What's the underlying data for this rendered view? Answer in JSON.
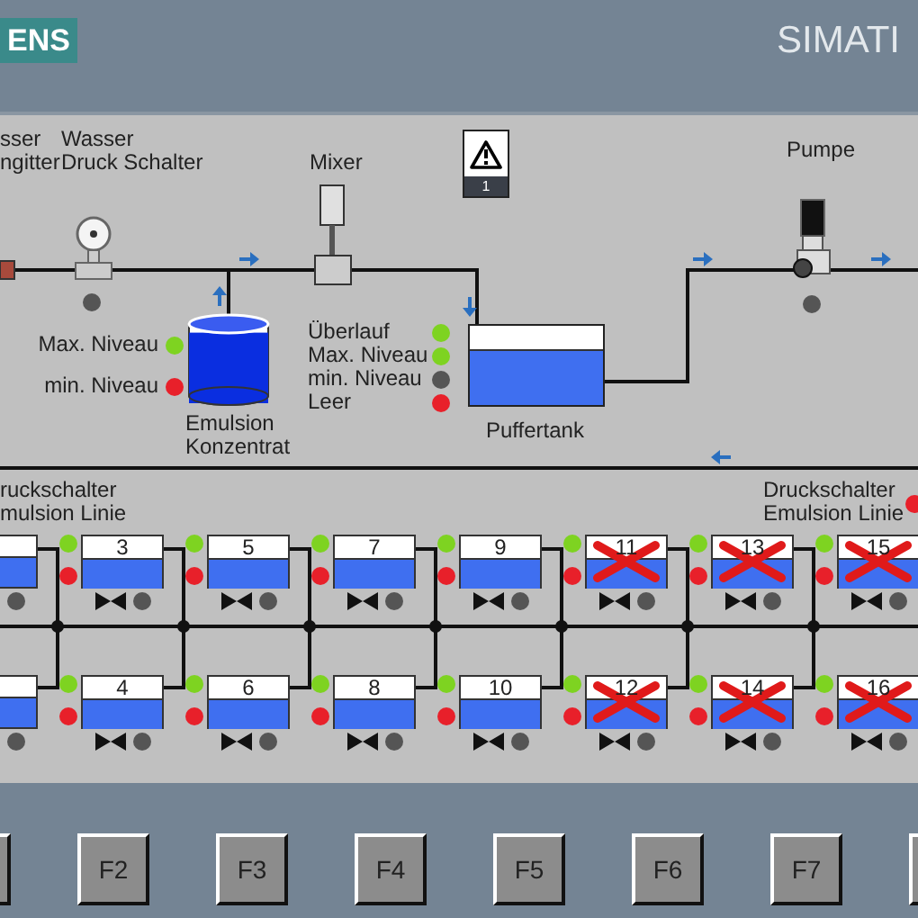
{
  "header": {
    "logo": "ENS",
    "brand": "SIMATI"
  },
  "filter": {
    "label_lines": [
      "sser",
      "ngitter"
    ]
  },
  "pressure_switch": {
    "label_lines": [
      "Wasser",
      "Druck Schalter"
    ],
    "lamp": {
      "color": "#555555"
    }
  },
  "mixer": {
    "label": "Mixer"
  },
  "alarm": {
    "count": "1"
  },
  "concentrate_tank": {
    "label_lines": [
      "Emulsion",
      "Konzentrat"
    ],
    "level": 0.88,
    "indicators": [
      {
        "label": "Max. Niveau",
        "color": "#7ed321"
      },
      {
        "label": "min. Niveau",
        "color": "#e8202a"
      }
    ]
  },
  "buffer_tank": {
    "label": "Puffertank",
    "indicators": [
      {
        "label": "Überlauf",
        "color": "#7ed321"
      },
      {
        "label": "Max. Niveau",
        "color": "#7ed321"
      },
      {
        "label": "min. Niveau",
        "color": "#555555"
      },
      {
        "label": "Leer",
        "color": "#e8202a"
      }
    ]
  },
  "pump": {
    "label": "Pumpe",
    "lamp": {
      "color": "#555555"
    }
  },
  "line_switch_left": {
    "label_lines": [
      "ruckschalter",
      "mulsion Linie"
    ]
  },
  "line_switch_right": {
    "label_lines": [
      "Druckschalter",
      "Emulsion Linie"
    ],
    "lamp": {
      "color": "#e8202a"
    }
  },
  "tank_rows": [
    [
      {
        "disabled": false,
        "valve_lamp": {
          "color": "#555555"
        }
      },
      {
        "number": "3",
        "disabled": false,
        "lamps": [
          {
            "color": "#7ed321"
          },
          {
            "color": "#e8202a"
          }
        ],
        "valve_lamp": {
          "color": "#555555"
        }
      },
      {
        "number": "5",
        "disabled": false,
        "lamps": [
          {
            "color": "#7ed321"
          },
          {
            "color": "#e8202a"
          }
        ],
        "valve_lamp": {
          "color": "#555555"
        }
      },
      {
        "number": "7",
        "disabled": false,
        "lamps": [
          {
            "color": "#7ed321"
          },
          {
            "color": "#e8202a"
          }
        ],
        "valve_lamp": {
          "color": "#555555"
        }
      },
      {
        "number": "9",
        "disabled": false,
        "lamps": [
          {
            "color": "#7ed321"
          },
          {
            "color": "#e8202a"
          }
        ],
        "valve_lamp": {
          "color": "#555555"
        }
      },
      {
        "number": "11",
        "disabled": true,
        "lamps": [
          {
            "color": "#7ed321"
          },
          {
            "color": "#e8202a"
          }
        ],
        "valve_lamp": {
          "color": "#555555"
        }
      },
      {
        "number": "13",
        "disabled": true,
        "lamps": [
          {
            "color": "#7ed321"
          },
          {
            "color": "#e8202a"
          }
        ],
        "valve_lamp": {
          "color": "#555555"
        }
      },
      {
        "number": "15",
        "disabled": true,
        "lamps": [
          {
            "color": "#7ed321"
          },
          {
            "color": "#e8202a"
          }
        ],
        "valve_lamp": {
          "color": "#555555"
        }
      }
    ],
    [
      {
        "disabled": false,
        "valve_lamp": {
          "color": "#555555"
        }
      },
      {
        "number": "4",
        "disabled": false,
        "lamps": [
          {
            "color": "#7ed321"
          },
          {
            "color": "#e8202a"
          }
        ],
        "valve_lamp": {
          "color": "#555555"
        }
      },
      {
        "number": "6",
        "disabled": false,
        "lamps": [
          {
            "color": "#7ed321"
          },
          {
            "color": "#e8202a"
          }
        ],
        "valve_lamp": {
          "color": "#555555"
        }
      },
      {
        "number": "8",
        "disabled": false,
        "lamps": [
          {
            "color": "#7ed321"
          },
          {
            "color": "#e8202a"
          }
        ],
        "valve_lamp": {
          "color": "#555555"
        }
      },
      {
        "number": "10",
        "disabled": false,
        "lamps": [
          {
            "color": "#7ed321"
          },
          {
            "color": "#e8202a"
          }
        ],
        "valve_lamp": {
          "color": "#555555"
        }
      },
      {
        "number": "12",
        "disabled": true,
        "lamps": [
          {
            "color": "#7ed321"
          },
          {
            "color": "#e8202a"
          }
        ],
        "valve_lamp": {
          "color": "#555555"
        }
      },
      {
        "number": "14",
        "disabled": true,
        "lamps": [
          {
            "color": "#7ed321"
          },
          {
            "color": "#e8202a"
          }
        ],
        "valve_lamp": {
          "color": "#555555"
        }
      },
      {
        "number": "16",
        "disabled": true,
        "lamps": [
          {
            "color": "#7ed321"
          },
          {
            "color": "#e8202a"
          }
        ],
        "valve_lamp": {
          "color": "#555555"
        }
      }
    ]
  ],
  "function_keys": [
    {
      "label": "F2"
    },
    {
      "label": "F3"
    },
    {
      "label": "F4"
    },
    {
      "label": "F5"
    },
    {
      "label": "F6"
    },
    {
      "label": "F7"
    }
  ]
}
